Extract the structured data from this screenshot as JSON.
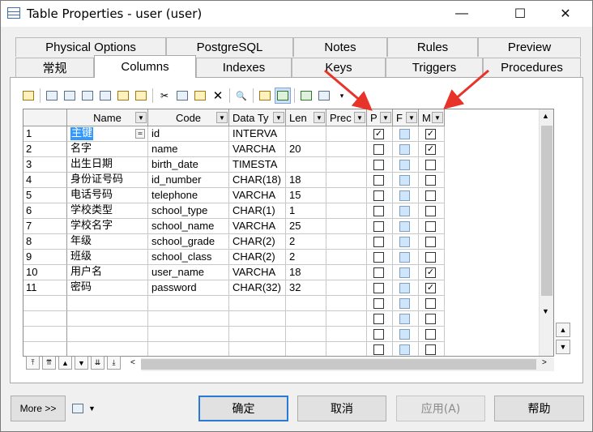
{
  "window": {
    "title": "Table Properties - user (user)",
    "minimize": "—",
    "maximize": "☐",
    "close": "✕"
  },
  "tabs_row1": [
    "Physical Options",
    "PostgreSQL",
    "Notes",
    "Rules",
    "Preview"
  ],
  "tabs_row2": [
    "常规",
    "Columns",
    "Indexes",
    "Keys",
    "Triggers",
    "Procedures"
  ],
  "active_tab": "Columns",
  "grid": {
    "headers": [
      "Name",
      "Code",
      "Data Ty",
      "Len",
      "Prec",
      "P",
      "F",
      "M"
    ],
    "rows": [
      {
        "num": "1",
        "name": "主键",
        "code": "id",
        "type": "INTERVA",
        "len": "",
        "p": true,
        "f": false,
        "m": true
      },
      {
        "num": "2",
        "name": "名字",
        "code": "name",
        "type": "VARCHA",
        "len": "20",
        "p": false,
        "f": false,
        "m": true
      },
      {
        "num": "3",
        "name": "出生日期",
        "code": "birth_date",
        "type": "TIMESTA",
        "len": "",
        "p": false,
        "f": false,
        "m": false
      },
      {
        "num": "4",
        "name": "身份证号码",
        "code": "id_number",
        "type": "CHAR(18)",
        "len": "18",
        "p": false,
        "f": false,
        "m": false
      },
      {
        "num": "5",
        "name": "电话号码",
        "code": "telephone",
        "type": "VARCHA",
        "len": "15",
        "p": false,
        "f": false,
        "m": false
      },
      {
        "num": "6",
        "name": "学校类型",
        "code": "school_type",
        "type": "CHAR(1)",
        "len": "1",
        "p": false,
        "f": false,
        "m": false
      },
      {
        "num": "7",
        "name": "学校名字",
        "code": "school_name",
        "type": "VARCHA",
        "len": "25",
        "p": false,
        "f": false,
        "m": false
      },
      {
        "num": "8",
        "name": "年级",
        "code": "school_grade",
        "type": "CHAR(2)",
        "len": "2",
        "p": false,
        "f": false,
        "m": false
      },
      {
        "num": "9",
        "name": "班级",
        "code": "school_class",
        "type": "CHAR(2)",
        "len": "2",
        "p": false,
        "f": false,
        "m": false
      },
      {
        "num": "10",
        "name": "用户名",
        "code": "user_name",
        "type": "VARCHA",
        "len": "18",
        "p": false,
        "f": false,
        "m": true
      },
      {
        "num": "11",
        "name": "密码",
        "code": "password",
        "type": "CHAR(32)",
        "len": "32",
        "p": false,
        "f": false,
        "m": true
      }
    ],
    "empty_rows": 5
  },
  "buttons": {
    "more": "More >>",
    "ok": "确定",
    "cancel": "取消",
    "apply": "应用(A)",
    "help": "帮助"
  },
  "colors": {
    "accent": "#2a7ad5",
    "selection": "#3399ff",
    "arrow": "#e8332a"
  }
}
